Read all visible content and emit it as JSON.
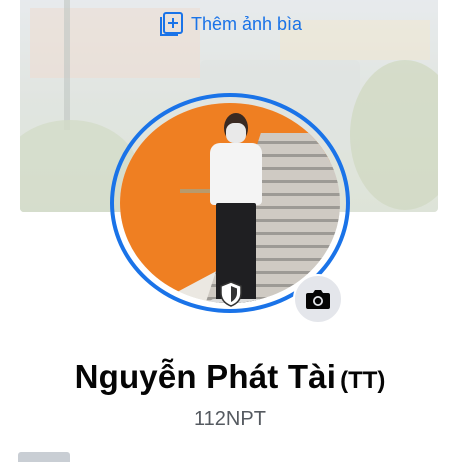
{
  "cover": {
    "add_cover_label": "Thêm ảnh bìa",
    "add_cover_icon": "add-photo-icon"
  },
  "profile": {
    "name": "Nguyễn Phát Tài",
    "name_suffix": "(TT)",
    "username": "112NPT",
    "avatar_guard_icon": "shield-icon",
    "camera_icon": "camera-icon"
  },
  "colors": {
    "accent": "#1a73e8",
    "text_primary": "#050505",
    "text_secondary": "#555a60",
    "camera_bg": "#e4e6eb"
  }
}
